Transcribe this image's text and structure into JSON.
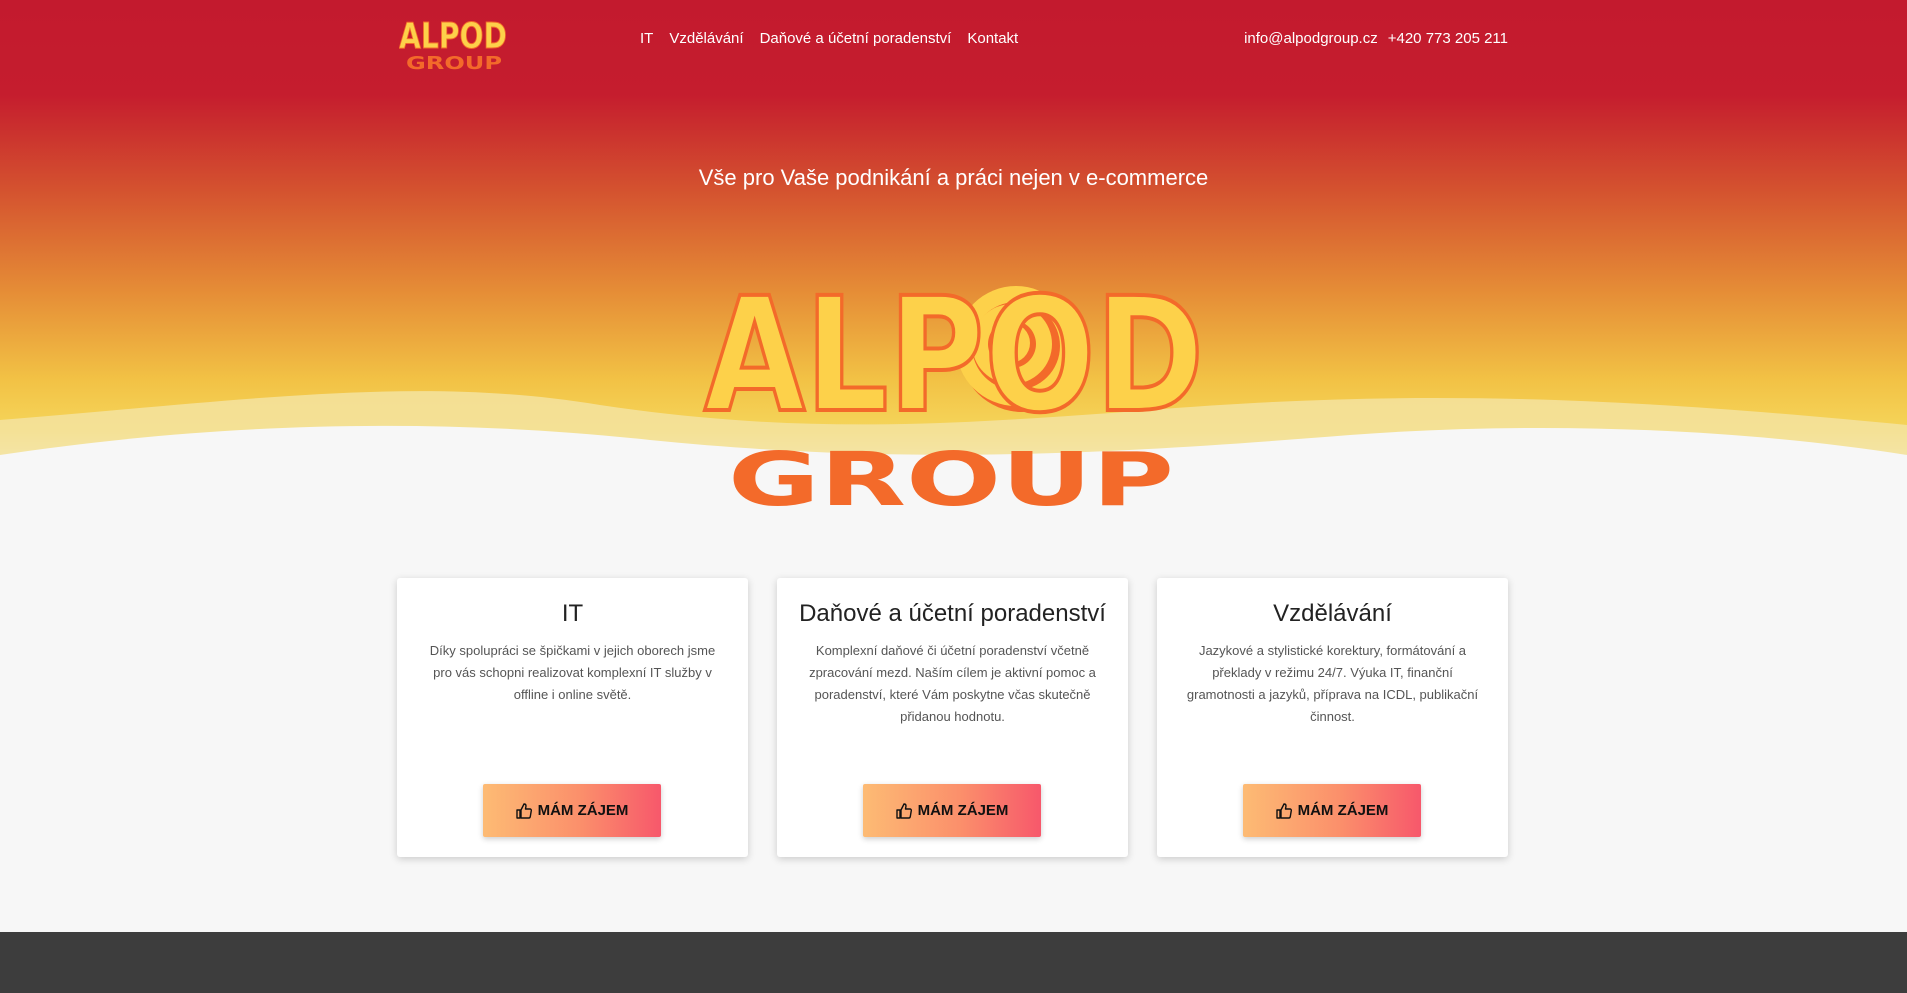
{
  "colors": {
    "hero_top": "#c31a2e",
    "hero_mid": "#e58c36",
    "hero_bottom": "#f5d55a",
    "logo_yellow": "#fdd14a",
    "logo_orange": "#f36a2a",
    "button_start": "#fdbb74",
    "button_end": "#f7586b",
    "footer": "#3d3d3d"
  },
  "nav": {
    "logo": {
      "word": "ALPOD",
      "sub": "GROUP"
    },
    "items": [
      {
        "label": "IT"
      },
      {
        "label": "Vzdělávání"
      },
      {
        "label": "Daňové a účetní poradenství"
      },
      {
        "label": "Kontakt"
      }
    ],
    "email": "info@alpodgroup.cz",
    "phone": "+420 773 205 211"
  },
  "hero": {
    "tagline": "Vše pro Vaše podnikání a práci nejen v e-commerce",
    "logo": {
      "word": "ALPOD",
      "sub": "GROUP"
    }
  },
  "cards": [
    {
      "title": "IT",
      "text": "Díky spolupráci se špičkami v jejich oborech jsme pro vás schopni realizovat komplexní IT služby v offline i online světě.",
      "button": "MÁM ZÁJEM",
      "button_icon": "thumbs-up-icon"
    },
    {
      "title": "Daňové a účetní poradenství",
      "text": "Komplexní daňové či účetní poradenství včetně zpracování mezd. Naším cílem je aktivní pomoc a poradenství, které Vám poskytne včas skutečně přidanou hodnotu.",
      "button": "MÁM ZÁJEM",
      "button_icon": "thumbs-up-icon"
    },
    {
      "title": "Vzdělávání",
      "text": "Jazykové a stylistické korektury, formátování a překlady v režimu 24/7. Výuka IT, finanční gramotnosti a jazyků, příprava na ICDL, publikační činnost.",
      "button": "MÁM ZÁJEM",
      "button_icon": "thumbs-up-icon"
    }
  ]
}
